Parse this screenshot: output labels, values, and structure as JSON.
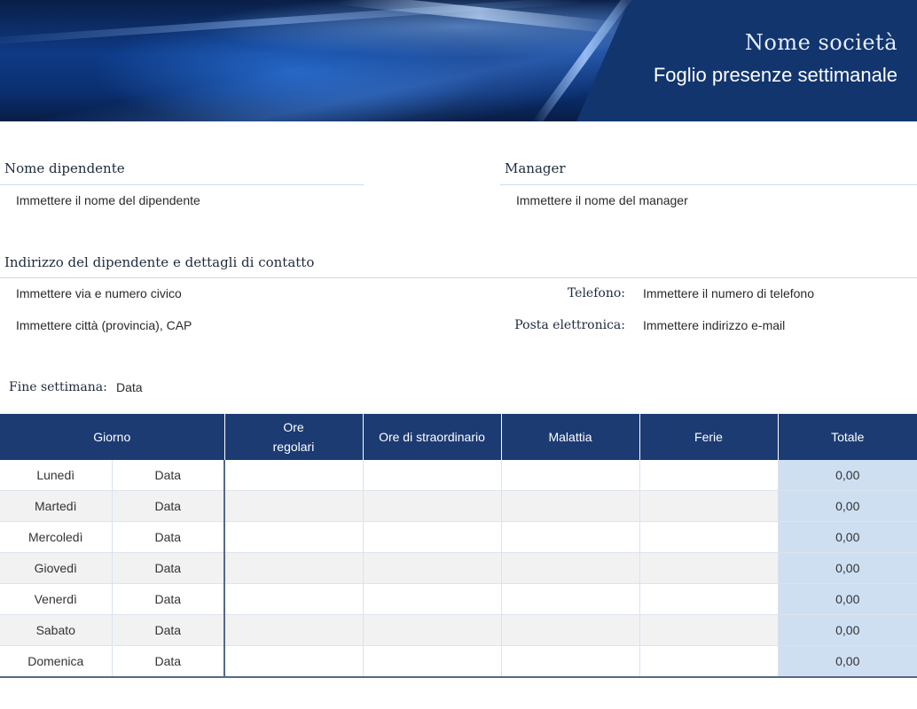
{
  "header": {
    "company": "Nome società",
    "title": "Foglio presenze settimanale"
  },
  "employee": {
    "label": "Nome dipendente",
    "value": "Immettere il nome del dipendente"
  },
  "manager": {
    "label": "Manager",
    "value": "Immettere il nome del manager"
  },
  "contact": {
    "label": "Indirizzo del dipendente e dettagli di contatto",
    "street": "Immettere via e numero civico",
    "city": "Immettere città (provincia), CAP",
    "phone_label": "Telefono:",
    "phone_value": "Immettere il numero di telefono",
    "email_label": "Posta elettronica:",
    "email_value": "Immettere indirizzo e-mail"
  },
  "week_end": {
    "label": "Fine settimana:",
    "value": "Data"
  },
  "table": {
    "headers": {
      "day": "Giorno",
      "regular_line1": "Ore",
      "regular_line2": "regolari",
      "overtime": "Ore di straordinario",
      "sick": "Malattia",
      "vacation": "Ferie",
      "total": "Totale"
    },
    "rows": [
      {
        "day": "Lunedì",
        "date": "Data",
        "total": "0,00"
      },
      {
        "day": "Martedì",
        "date": "Data",
        "total": "0,00"
      },
      {
        "day": "Mercoledì",
        "date": "Data",
        "total": "0,00"
      },
      {
        "day": "Giovedì",
        "date": "Data",
        "total": "0,00"
      },
      {
        "day": "Venerdì",
        "date": "Data",
        "total": "0,00"
      },
      {
        "day": "Sabato",
        "date": "Data",
        "total": "0,00"
      },
      {
        "day": "Domenica",
        "date": "Data",
        "total": "0,00"
      }
    ]
  },
  "colors": {
    "header_bg": "#1c3b73",
    "total_cell_bg": "#cfdff2",
    "alt_row_bg": "#f2f2f2"
  }
}
